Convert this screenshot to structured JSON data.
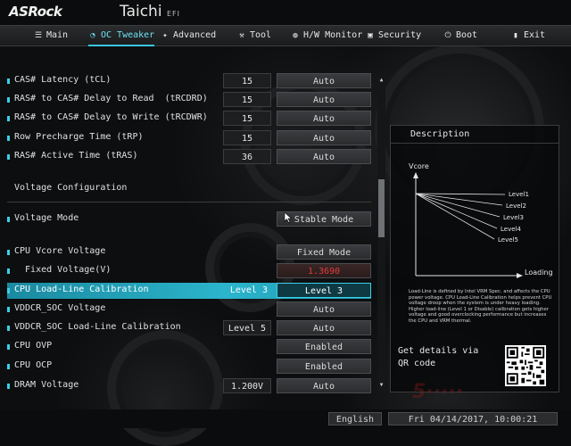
{
  "header": {
    "brand": "ASRock",
    "product": "Taichi",
    "product_suffix": "EFI"
  },
  "nav": {
    "tabs": [
      {
        "label": "Main",
        "icon": "list-icon"
      },
      {
        "label": "OC Tweaker",
        "icon": "rocket-icon",
        "active": true
      },
      {
        "label": "Advanced",
        "icon": "star-icon"
      },
      {
        "label": "Tool",
        "icon": "hammer-icon"
      },
      {
        "label": "H/W Monitor",
        "icon": "monitor-icon"
      },
      {
        "label": "Security",
        "icon": "shield-icon"
      },
      {
        "label": "Boot",
        "icon": "power-icon"
      },
      {
        "label": "Exit",
        "icon": "exit-icon"
      }
    ]
  },
  "settings": {
    "cas_latency": {
      "label": "CAS# Latency (tCL)",
      "value": "15",
      "option": "Auto"
    },
    "ras_to_cas_read": {
      "label": "RAS# to CAS# Delay to Read  (tRCDRD)",
      "value": "15",
      "option": "Auto"
    },
    "ras_to_cas_write": {
      "label": "RAS# to CAS# Delay to Write (tRCDWR)",
      "value": "15",
      "option": "Auto"
    },
    "row_precharge": {
      "label": "Row Precharge Time (tRP)",
      "value": "15",
      "option": "Auto"
    },
    "ras_active": {
      "label": "RAS# Active Time (tRAS)",
      "value": "36",
      "option": "Auto"
    },
    "voltage_section": "Voltage Configuration",
    "voltage_mode": {
      "label": "Voltage Mode",
      "option": "Stable Mode"
    },
    "cpu_vcore": {
      "label": "CPU Vcore Voltage",
      "option": "Fixed Mode"
    },
    "fixed_voltage": {
      "label": "  Fixed Voltage(V)",
      "option": "1.3690"
    },
    "cpu_llc": {
      "label": "CPU Load-Line Calibration",
      "value": "Level 3",
      "option": "Level 3"
    },
    "vddcr_soc": {
      "label": "VDDCR_SOC Voltage",
      "option": "Auto"
    },
    "vddcr_soc_llc": {
      "label": "VDDCR_SOC Load-Line Calibration",
      "value": "Level 5",
      "option": "Auto"
    },
    "cpu_ovp": {
      "label": "CPU OVP",
      "option": "Enabled"
    },
    "cpu_ocp": {
      "label": "CPU OCP",
      "option": "Enabled"
    },
    "dram_voltage": {
      "label": "DRAM Voltage",
      "value": "1.200V",
      "option": "Auto"
    }
  },
  "description": {
    "title": "Description",
    "graph": {
      "ylabel": "Vcore",
      "xlabel": "Loading",
      "levels": [
        "Level1",
        "Level2",
        "Level3",
        "Level4",
        "Level5"
      ]
    },
    "text": "Load-Line is defined by Intel VRM Spec. and affects the CPU power voltage. CPU Load-Line Calibration helps prevent CPU voltage droop when the system is under heavy loading. Higher load-line (Level 1 or Disable) calibration gets higher voltage and good overclocking performance but increases the CPU and VRM thermal.",
    "qr_text": "Get details via QR code"
  },
  "footer": {
    "language": "English",
    "datetime": "Fri 04/14/2017, 10:00:21"
  },
  "colors": {
    "accent": "#38c6e0",
    "warning_value": "#e23b3b"
  }
}
